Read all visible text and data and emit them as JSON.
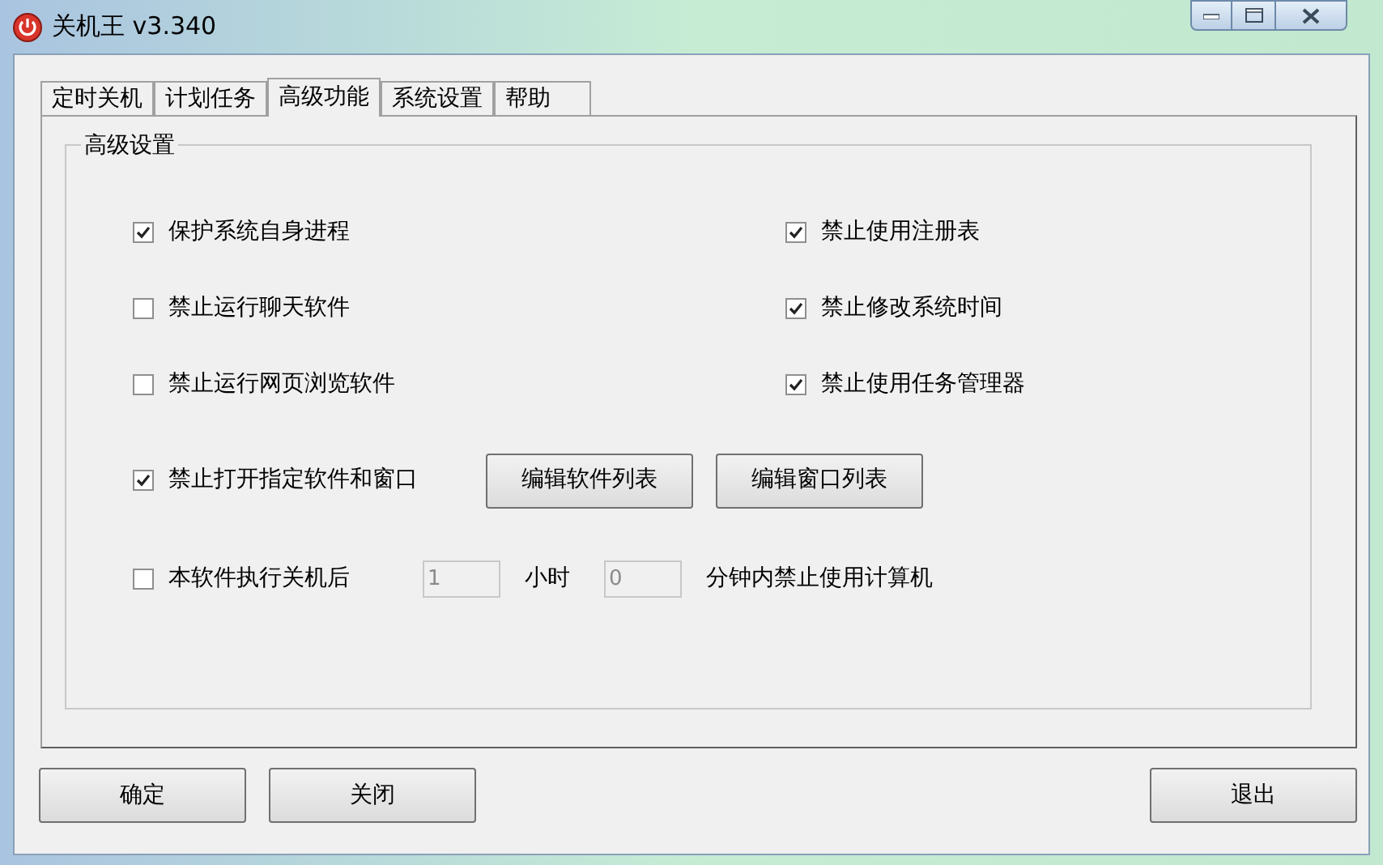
{
  "window": {
    "title": "关机王 v3.340"
  },
  "tabs": [
    {
      "label": "定时关机",
      "selected": false
    },
    {
      "label": "计划任务",
      "selected": false
    },
    {
      "label": "高级功能",
      "selected": true
    },
    {
      "label": "系统设置",
      "selected": false
    },
    {
      "label": "帮助",
      "selected": false
    }
  ],
  "group": {
    "title": "高级设置",
    "options": [
      {
        "label": "保护系统自身进程",
        "checked": true
      },
      {
        "label": "禁止使用注册表",
        "checked": true
      },
      {
        "label": "禁止运行聊天软件",
        "checked": false
      },
      {
        "label": "禁止修改系统时间",
        "checked": true
      },
      {
        "label": "禁止运行网页浏览软件",
        "checked": false
      },
      {
        "label": "禁止使用任务管理器",
        "checked": true
      }
    ],
    "block_row": {
      "label": "禁止打开指定软件和窗口",
      "checked": true,
      "buttons": [
        "编辑软件列表",
        "编辑窗口列表"
      ]
    },
    "lock_row": {
      "label": "本软件执行关机后",
      "checked": false,
      "hours": {
        "value": "1",
        "disabled": true
      },
      "hours_unit": "小时",
      "minutes": {
        "value": "0",
        "disabled": true
      },
      "suffix": "分钟内禁止使用计算机"
    }
  },
  "left_buttons": [
    "确定",
    "关闭"
  ],
  "right_buttons": [
    "退出"
  ]
}
